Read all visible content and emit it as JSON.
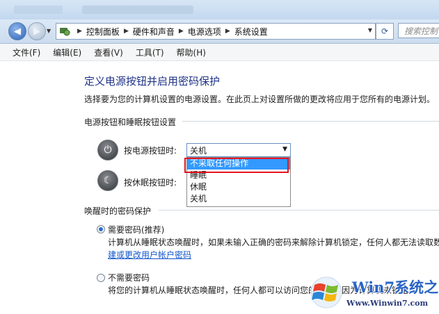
{
  "navigation": {
    "breadcrumbs": [
      "控制面板",
      "硬件和声音",
      "电源选项",
      "系统设置"
    ],
    "search_placeholder": "搜索控制"
  },
  "menu": [
    "文件(F)",
    "编辑(E)",
    "查看(V)",
    "工具(T)",
    "帮助(H)"
  ],
  "page": {
    "title": "定义电源按钮并启用密码保护",
    "description": "选择要为您的计算机设置的电源设置。在此页上对设置所做的更改将应用于您所有的电源计划。"
  },
  "power_buttons": {
    "heading": "电源按钮和睡眠按钮设置",
    "power_label": "按电源按钮时:",
    "power_value": "关机",
    "sleep_label": "按休眠按钮时:",
    "dropdown_options": [
      "不采取任何操作",
      "睡眠",
      "休眠",
      "关机"
    ],
    "highlighted_option": "不采取任何操作"
  },
  "wake_password": {
    "heading": "唤醒时的密码保护",
    "option_require": "需要密码(推荐)",
    "option_require_desc": "计算机从睡眠状态唤醒时，如果未输入正确的密码来解除计算机锁定，任何人都无法读取数",
    "link_text": "建或更改用户帐户密码",
    "option_no": "不需要密码",
    "option_no_desc": "将您的计算机从睡眠状态唤醒时，任何人都可以访问您的数据，因为计算机未锁定。"
  },
  "watermark": {
    "main": "Win7系统之家",
    "url": "Www.Winwin7.com"
  },
  "colors": {
    "title_blue": "#1e3287",
    "link_blue": "#1155cc",
    "highlight": "#3399ff",
    "red_outline": "#e8141f"
  }
}
